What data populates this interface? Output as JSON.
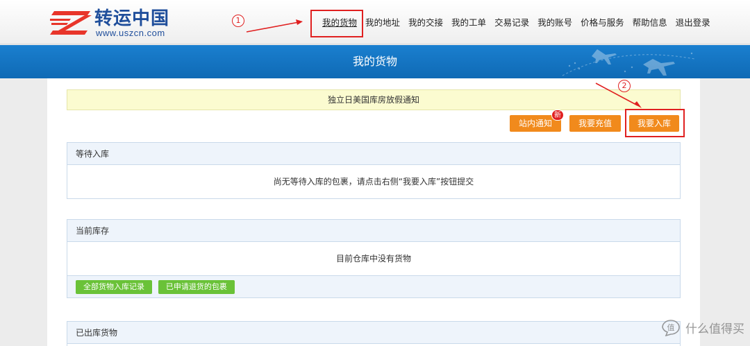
{
  "header": {
    "logo_cn": "转运中国",
    "logo_url": "www.uszcn.com",
    "nav": [
      {
        "label": "我的货物",
        "active": true
      },
      {
        "label": "我的地址"
      },
      {
        "label": "我的交接"
      },
      {
        "label": "我的工单"
      },
      {
        "label": "交易记录"
      },
      {
        "label": "我的账号"
      },
      {
        "label": "价格与服务"
      },
      {
        "label": "帮助信息"
      },
      {
        "label": "退出登录"
      }
    ]
  },
  "banner": {
    "title": "我的货物"
  },
  "notice": "独立日美国库房放假通知",
  "actions": {
    "site_notice": "站内通知",
    "new_badge": "新",
    "recharge": "我要充值",
    "inbound": "我要入库"
  },
  "panels": {
    "waiting": {
      "title": "等待入库",
      "empty_text": "尚无等待入库的包裹，请点击右侧“我要入库”按钮提交"
    },
    "inventory": {
      "title": "当前库存",
      "empty_text": "目前仓库中没有货物",
      "buttons": [
        "全部货物入库记录",
        "已申请退货的包裹"
      ]
    },
    "shipped": {
      "title": "已出库货物"
    }
  },
  "annotations": {
    "step1": "1",
    "step2": "2"
  },
  "watermark": {
    "text": "什么值得买",
    "icon": "zhi-icon"
  },
  "colors": {
    "banner_blue": "#1479c9",
    "orange_button": "#f18a1c",
    "green_button": "#6ac238",
    "annotation_red": "#e02020",
    "notice_yellow": "#fbfbd0"
  }
}
